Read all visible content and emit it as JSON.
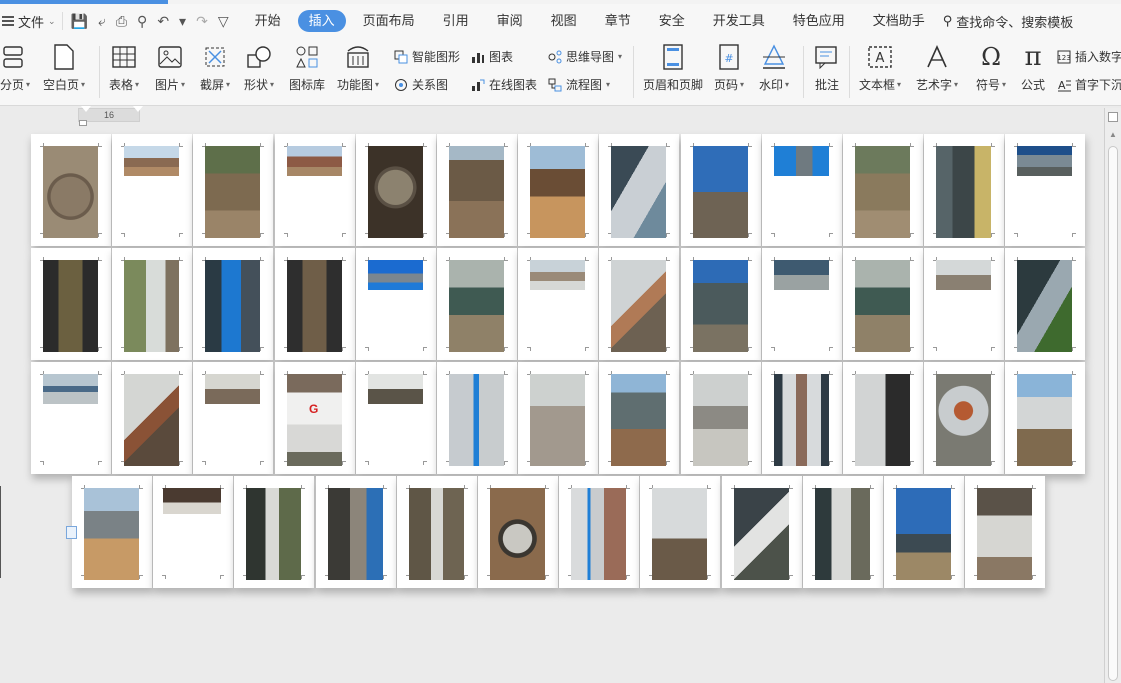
{
  "menu": {
    "file_label": "文件",
    "tabs": [
      "开始",
      "插入",
      "页面布局",
      "引用",
      "审阅",
      "视图",
      "章节",
      "安全",
      "开发工具",
      "特色应用",
      "文档助手"
    ],
    "active_tab": "插入",
    "search_label": "查找命令、搜索模板"
  },
  "ribbon": {
    "page_break": "分页",
    "blank_page": "空白页",
    "table": "表格",
    "picture": "图片",
    "screenshot": "截屏",
    "shapes": "形状",
    "icon_library": "图标库",
    "function_chart": "功能图",
    "smart_shape": "智能图形",
    "chart": "图表",
    "mind_map": "思维导图",
    "relation_chart": "关系图",
    "online_chart": "在线图表",
    "flowchart": "流程图",
    "header_footer": "页眉和页脚",
    "page_number": "页码",
    "watermark": "水印",
    "comment": "批注",
    "text_box": "文本框",
    "word_art": "艺术字",
    "symbol": "符号",
    "formula": "公式",
    "insert_number": "插入数字",
    "drop_cap": "首字下沉"
  },
  "ruler": {
    "value": "16"
  },
  "colors": {
    "accent": "#4a90e2",
    "background": "#ebebeb",
    "page": "#ffffff"
  },
  "pages": [
    {
      "t": "full",
      "bg": "radial-gradient(circle at 50% 55%, #8a7a66 0 34%, #6b5c4c 35% 40%, #9a8b75 41%)"
    },
    {
      "t": "half",
      "bg": "linear-gradient(#c5d8e8 0 40%, #8a6a52 40% 70%, #b08a66 70%)"
    },
    {
      "t": "full",
      "bg": "linear-gradient(#5e6f4a 0 30%, #7d6a50 30% 70%, #9a8468 70%)"
    },
    {
      "t": "half",
      "bg": "linear-gradient(#b6cbe0 0 35%, #8d5a45 35% 70%, #a78766 70%)"
    },
    {
      "t": "full",
      "bg": "radial-gradient(circle at 50% 45%, #8c826f 0 30%, #5a5044 31% 36%, #3c3228 37%)"
    },
    {
      "t": "full",
      "bg": "linear-gradient(#a5b8c6 0 15%, #6b5a46 15% 60%, #8a7258 60%)"
    },
    {
      "t": "full",
      "bg": "linear-gradient(#9ebcd6 0 25%, #6a4d35 25% 55%, #c7955e 55%)"
    },
    {
      "t": "full",
      "bg": "linear-gradient(120deg, #3a4a55 0 35%, #c9cfd4 35% 70%, #6e8a9c 70%)"
    },
    {
      "t": "full",
      "bg": "linear-gradient(#2f6db8 0 50%, #6e6354 50%)"
    },
    {
      "t": "half",
      "bg": "linear-gradient(90deg, #1f7fd6 0 40%, #6f7a80 40% 70%, #1f7fd6 70%)"
    },
    {
      "t": "full",
      "bg": "linear-gradient(#6c7a5c 0 30%, #8a7a5d 30% 70%, #a08d72 70%)"
    },
    {
      "t": "full",
      "bg": "linear-gradient(90deg, #566468 0 30%, #3c4648 30% 70%, #c8b468 70%)"
    },
    {
      "t": "half",
      "bg": "linear-gradient(#1e4f8a 0 30%, #7a8a94 30% 70%, #585f5e 70%)"
    },
    {
      "t": "full",
      "bg": "linear-gradient(90deg, #2b2b2b 0 28%, #6b6040 28% 72%, #2b2b2b 72%)"
    },
    {
      "t": "full",
      "bg": "linear-gradient(90deg, #7b8a5c 0 40%, #d8dcd9 40% 75%, #7e7260 75%)"
    },
    {
      "t": "full",
      "bg": "linear-gradient(90deg, #2a3a44 0 30%, #1d78d0 30% 65%, #44505a 65%)"
    },
    {
      "t": "full",
      "bg": "linear-gradient(90deg, #2e2e2e 0 28%, #6f5e48 28% 72%, #2e2e2e 72%)"
    },
    {
      "t": "half",
      "bg": "linear-gradient(#1b6bd0 0 45%, #7a8690 45% 75%, #1e7ad8 75%)"
    },
    {
      "t": "full",
      "bg": "linear-gradient(#aab3ad 0 30%, #3f5a52 30% 60%, #8f8168 60%)"
    },
    {
      "t": "half",
      "bg": "linear-gradient(#c8d2d8 0 40%, #9a8a78 40% 70%, #d6d8d6 70%)"
    },
    {
      "t": "full",
      "bg": "linear-gradient(135deg, #cfd3d4 0 45%, #b07a56 45% 60%, #6d6152 60%)"
    },
    {
      "t": "full",
      "bg": "linear-gradient(#2d6bb6 0 25%, #4b5a5c 25% 70%, #7a7262 70%)"
    },
    {
      "t": "half",
      "bg": "linear-gradient(#3e5a70 0 50%, #9aa2a2 50%)"
    },
    {
      "t": "full",
      "bg": "linear-gradient(#aab3ad 0 30%, #3f5a52 30% 60%, #8f8168 60%)"
    },
    {
      "t": "half",
      "bg": "linear-gradient(#d4d8d8 0 50%, #8a8072 50%)"
    },
    {
      "t": "full",
      "bg": "linear-gradient(120deg, #2c3a3e 0 40%, #9aa8b0 40% 65%, #3e6a2e 65%)"
    },
    {
      "t": "half",
      "bg": "linear-gradient(#b7c6d0 0 40%, #4a6a88 40% 60%, #bcc3c6 60%)"
    },
    {
      "t": "full",
      "bg": "linear-gradient(135deg, #d4d6d3 0 45%, #8a5236 45% 60%, #5a4a3c 60%)"
    },
    {
      "t": "half",
      "bg": "linear-gradient(#d6d6d0 0 50%, #7a6a5a 50%)"
    },
    {
      "t": "full",
      "g": true,
      "bg": "linear-gradient(#7a6a5c 0 20%, #f0f0ef 20% 55%, #d8d8d6 55% 85%, #6a6a5c 85%)"
    },
    {
      "t": "half",
      "bg": "linear-gradient(#e2e4e2 0 50%, #5a5448 50%)"
    },
    {
      "t": "full",
      "bg": "linear-gradient(90deg, #c6cbcf 0 45%, #1f7fd6 45% 55%, #c8ccce 55%)"
    },
    {
      "t": "full",
      "bg": "linear-gradient(#cdd1cf 0 35%, #a2998e 35%)"
    },
    {
      "t": "full",
      "bg": "linear-gradient(#8fb5d6 0 20%, #5f6e70 20% 60%, #8e6a4c 60%)"
    },
    {
      "t": "full",
      "bg": "linear-gradient(#cdd0cf 0 35%, #8c8a84 35% 60%, #c7c6c0 60%)"
    },
    {
      "t": "full",
      "bg": "linear-gradient(90deg, #2d3a44 0 15%, #d7dadc 15% 40%, #8a6a5a 40% 60%, #d7dadc 60% 85%, #2d3a44 85%)"
    },
    {
      "t": "full",
      "bg": "linear-gradient(90deg, #d2d4d4 0 55%, #2b2b2b 55%)"
    },
    {
      "t": "full",
      "bg": "radial-gradient(circle at 50% 40%, #b55a32 0 15%, #c8ccce 16% 40%, #7a7a72 41%)"
    },
    {
      "t": "full",
      "bg": "linear-gradient(#8ab4d8 0 25%, #d3d6d6 25% 60%, #7f6a4e 60%)"
    },
    {
      "t": "full",
      "bg": "linear-gradient(#a9c2d8 0 25%, #7a8286 25% 55%, #c79a66 55%)"
    },
    {
      "t": "small",
      "bg": "linear-gradient(#4a3a30 0 55%, #d9d6cf 55%)"
    },
    {
      "t": "full",
      "bg": "linear-gradient(90deg, #2f3530 0 35%, #d9dad6 35% 60%, #5e6a4a 60%)"
    },
    {
      "t": "full",
      "bg": "linear-gradient(90deg, #3b3a36 0 40%, #8c857a 40% 70%, #2c6fb6 70%)"
    },
    {
      "t": "full",
      "bg": "linear-gradient(90deg, #5f5646 0 40%, #d8d8d4 40% 62%, #6e6452 62%)"
    },
    {
      "t": "full",
      "bg": "radial-gradient(circle at 50% 55%, #c9c8c2 0 25%, #3a3630 26% 33%, #8a6a4c 34%)"
    },
    {
      "t": "full",
      "bg": "linear-gradient(90deg, #d9dbdc 0 30%, #1f7fd6 30% 35%, #c9ccce 35% 60%, #9a6b58 60%)"
    },
    {
      "t": "full",
      "bg": "linear-gradient(#d7dadb 0 55%, #6a5a48 55%)"
    },
    {
      "t": "full",
      "bg": "linear-gradient(135deg, #3a4348 0 40%, #e2e3e2 40% 62%, #4c524a 62%)"
    },
    {
      "t": "full",
      "bg": "linear-gradient(90deg, #2e3a3c 0 30%, #d9dad8 30% 65%, #6a6a5c 65%)"
    },
    {
      "t": "full",
      "bg": "linear-gradient(#2d6cb8 0 50%, #3c4a52 50% 70%, #9c8866 70%)"
    },
    {
      "t": "full",
      "bg": "linear-gradient(#5a5248 0 30%, #d6d6d2 30% 75%, #8a7864 75%)"
    }
  ]
}
